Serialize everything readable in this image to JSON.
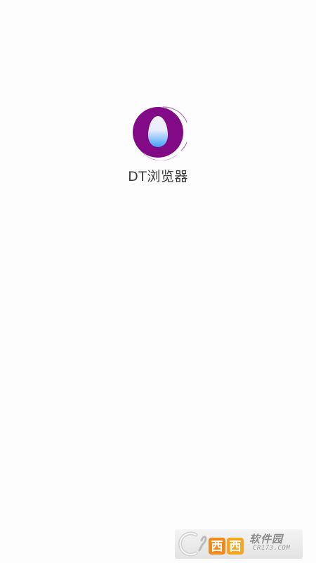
{
  "app": {
    "name": "DT浏览器"
  },
  "logo": {
    "icon": "droplet-logo-icon",
    "ring_color": "#820a87",
    "drop_top_color": "#f2f0fa",
    "drop_bottom_color": "#3ea2f7"
  },
  "watermark": {
    "cn_text": "软件园",
    "domain_text": "CR173.COM"
  },
  "colors": {
    "background": "#fdfdfd",
    "text": "#3c3c3c"
  }
}
